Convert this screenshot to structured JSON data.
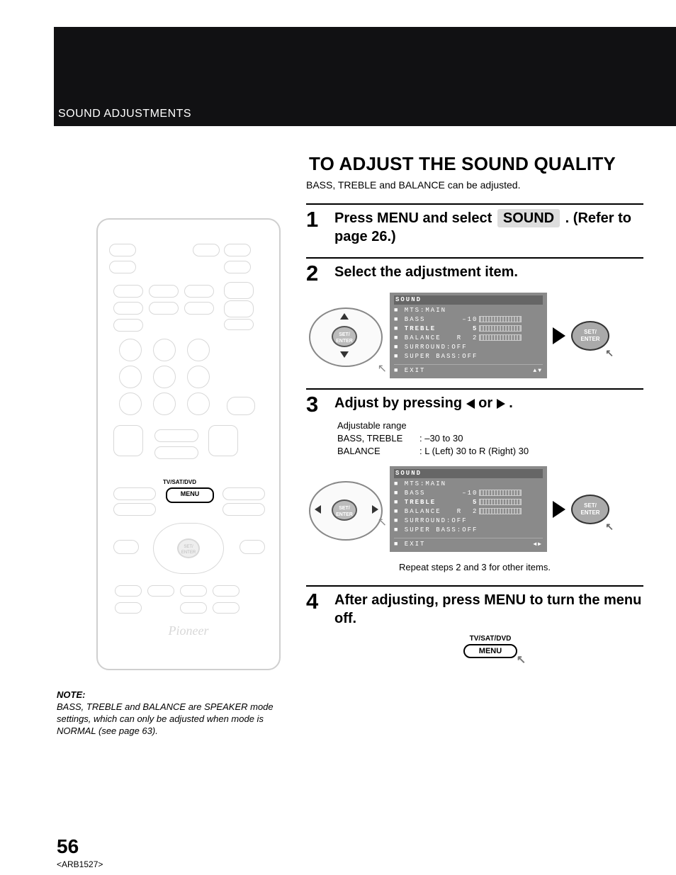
{
  "header": {
    "section": "SOUND ADJUSTMENTS"
  },
  "page": {
    "title": "TO ADJUST THE SOUND QUALITY",
    "subtitle": "BASS, TREBLE and BALANCE can be adjusted."
  },
  "steps": {
    "s1": {
      "num": "1",
      "pre": "Press MENU and select ",
      "chip": "SOUND",
      "post": " . (Refer to page 26.)"
    },
    "s2": {
      "num": "2",
      "title": "Select the adjustment item."
    },
    "s3": {
      "num": "3",
      "title_pre": "Adjust by pressing ",
      "title_post": " .",
      "range_hdr": "Adjustable range",
      "range1_lbl": "BASS, TREBLE",
      "range1_val": ": –30 to 30",
      "range2_lbl": "BALANCE",
      "range2_val": ": L (Left) 30 to R (Right) 30",
      "repeat": "Repeat steps 2 and 3 for other items."
    },
    "s4": {
      "num": "4",
      "title": "After adjusting, press MENU to turn the menu off."
    }
  },
  "osd": {
    "title": "SOUND",
    "rows": {
      "mts": "■ MTS:MAIN",
      "bass": "■ BASS       –10",
      "treble": "■ TREBLE       5",
      "balance": "■ BALANCE   R  2",
      "surround": "■ SURROUND:OFF",
      "super": "■ SUPER BASS:OFF"
    },
    "exit": "■ EXIT"
  },
  "buttons": {
    "set_enter": "SET/\nENTER",
    "menu_label_top": "TV/SAT/DVD",
    "menu": "MENU"
  },
  "remote": {
    "brand": "Pioneer",
    "menu_top": "TV/SAT/DVD",
    "menu": "MENU",
    "set_enter": "SET/\nENTER"
  },
  "note": {
    "hd": "NOTE:",
    "bd": "BASS, TREBLE and BALANCE are SPEAKER mode settings, which can only be adjusted when mode is NORMAL (see page 63)."
  },
  "footer": {
    "page": "56",
    "code": "<ARB1527>"
  }
}
